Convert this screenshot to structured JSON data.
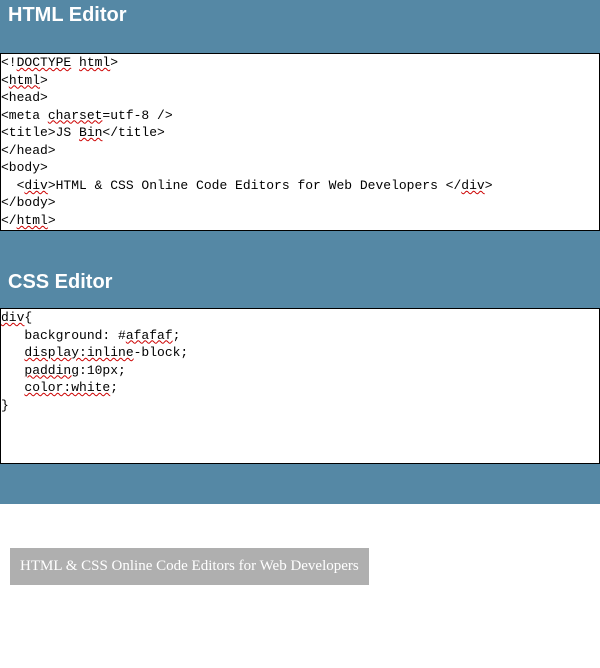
{
  "headers": {
    "html": "HTML Editor",
    "css": "CSS Editor"
  },
  "html_editor": {
    "tokens": [
      {
        "t": "<!",
        "sq": false
      },
      {
        "t": "DOCTYPE",
        "sq": true
      },
      {
        "t": " ",
        "sq": false
      },
      {
        "t": "html",
        "sq": true
      },
      {
        "t": ">",
        "sq": false
      },
      {
        "t": "\n<",
        "sq": false
      },
      {
        "t": "html",
        "sq": true
      },
      {
        "t": ">",
        "sq": false
      },
      {
        "t": "\n<head>",
        "sq": false
      },
      {
        "t": "\n<meta ",
        "sq": false
      },
      {
        "t": "charset",
        "sq": true
      },
      {
        "t": "=utf-8 />",
        "sq": false
      },
      {
        "t": "\n<title>JS ",
        "sq": false
      },
      {
        "t": "Bin",
        "sq": true
      },
      {
        "t": "</title>",
        "sq": false
      },
      {
        "t": "\n</head>",
        "sq": false
      },
      {
        "t": "\n<body>",
        "sq": false
      },
      {
        "t": "\n  <",
        "sq": false
      },
      {
        "t": "div",
        "sq": true
      },
      {
        "t": ">HTML & CSS Online Code Editors for Web Developers </",
        "sq": false
      },
      {
        "t": "div",
        "sq": true
      },
      {
        "t": ">",
        "sq": false
      },
      {
        "t": "\n</body>",
        "sq": false
      },
      {
        "t": "\n</",
        "sq": false
      },
      {
        "t": "html",
        "sq": true
      },
      {
        "t": ">",
        "sq": false
      }
    ]
  },
  "css_editor": {
    "tokens": [
      {
        "t": "div",
        "sq": true
      },
      {
        "t": "{",
        "sq": false
      },
      {
        "t": "\n   background: #",
        "sq": false
      },
      {
        "t": "afafaf",
        "sq": true
      },
      {
        "t": ";",
        "sq": false
      },
      {
        "t": "\n   ",
        "sq": false
      },
      {
        "t": "display:inline",
        "sq": true
      },
      {
        "t": "-block;",
        "sq": false
      },
      {
        "t": "\n   ",
        "sq": false
      },
      {
        "t": "padding",
        "sq": true
      },
      {
        "t": ":10px;",
        "sq": false
      },
      {
        "t": "\n   ",
        "sq": false
      },
      {
        "t": "color:white",
        "sq": true
      },
      {
        "t": ";",
        "sq": false
      },
      {
        "t": "\n}",
        "sq": false
      }
    ]
  },
  "output": {
    "text": "HTML & CSS Online Code Editors for Web Developers"
  }
}
